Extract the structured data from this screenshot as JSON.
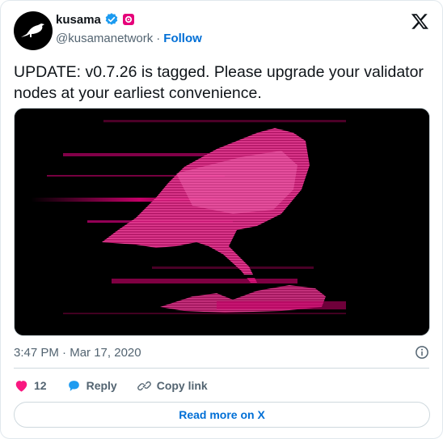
{
  "author": {
    "name": "kusama",
    "handle": "@kusamanetwork",
    "separator": "·",
    "follow_label": "Follow"
  },
  "tweet": {
    "text": "UPDATE: v0.7.26 is tagged. Please upgrade your validator nodes at your earliest convenience.",
    "time": "3:47 PM",
    "date_separator": "·",
    "date": "Mar 17, 2020"
  },
  "actions": {
    "like_count": "12",
    "reply_label": "Reply",
    "copy_link_label": "Copy link"
  },
  "footer": {
    "read_more_label": "Read more on X"
  },
  "colors": {
    "accent": "#006fd6",
    "like": "#f91880",
    "verified": "#1d9bf0",
    "media_pink": "#e6007a",
    "text": "#0f1419",
    "muted": "#536471"
  },
  "icons": [
    "kusama-bird-logo-icon",
    "verified-badge-icon",
    "org-badge-icon",
    "x-logo-icon",
    "info-icon",
    "heart-icon",
    "reply-bubble-icon",
    "link-icon"
  ]
}
